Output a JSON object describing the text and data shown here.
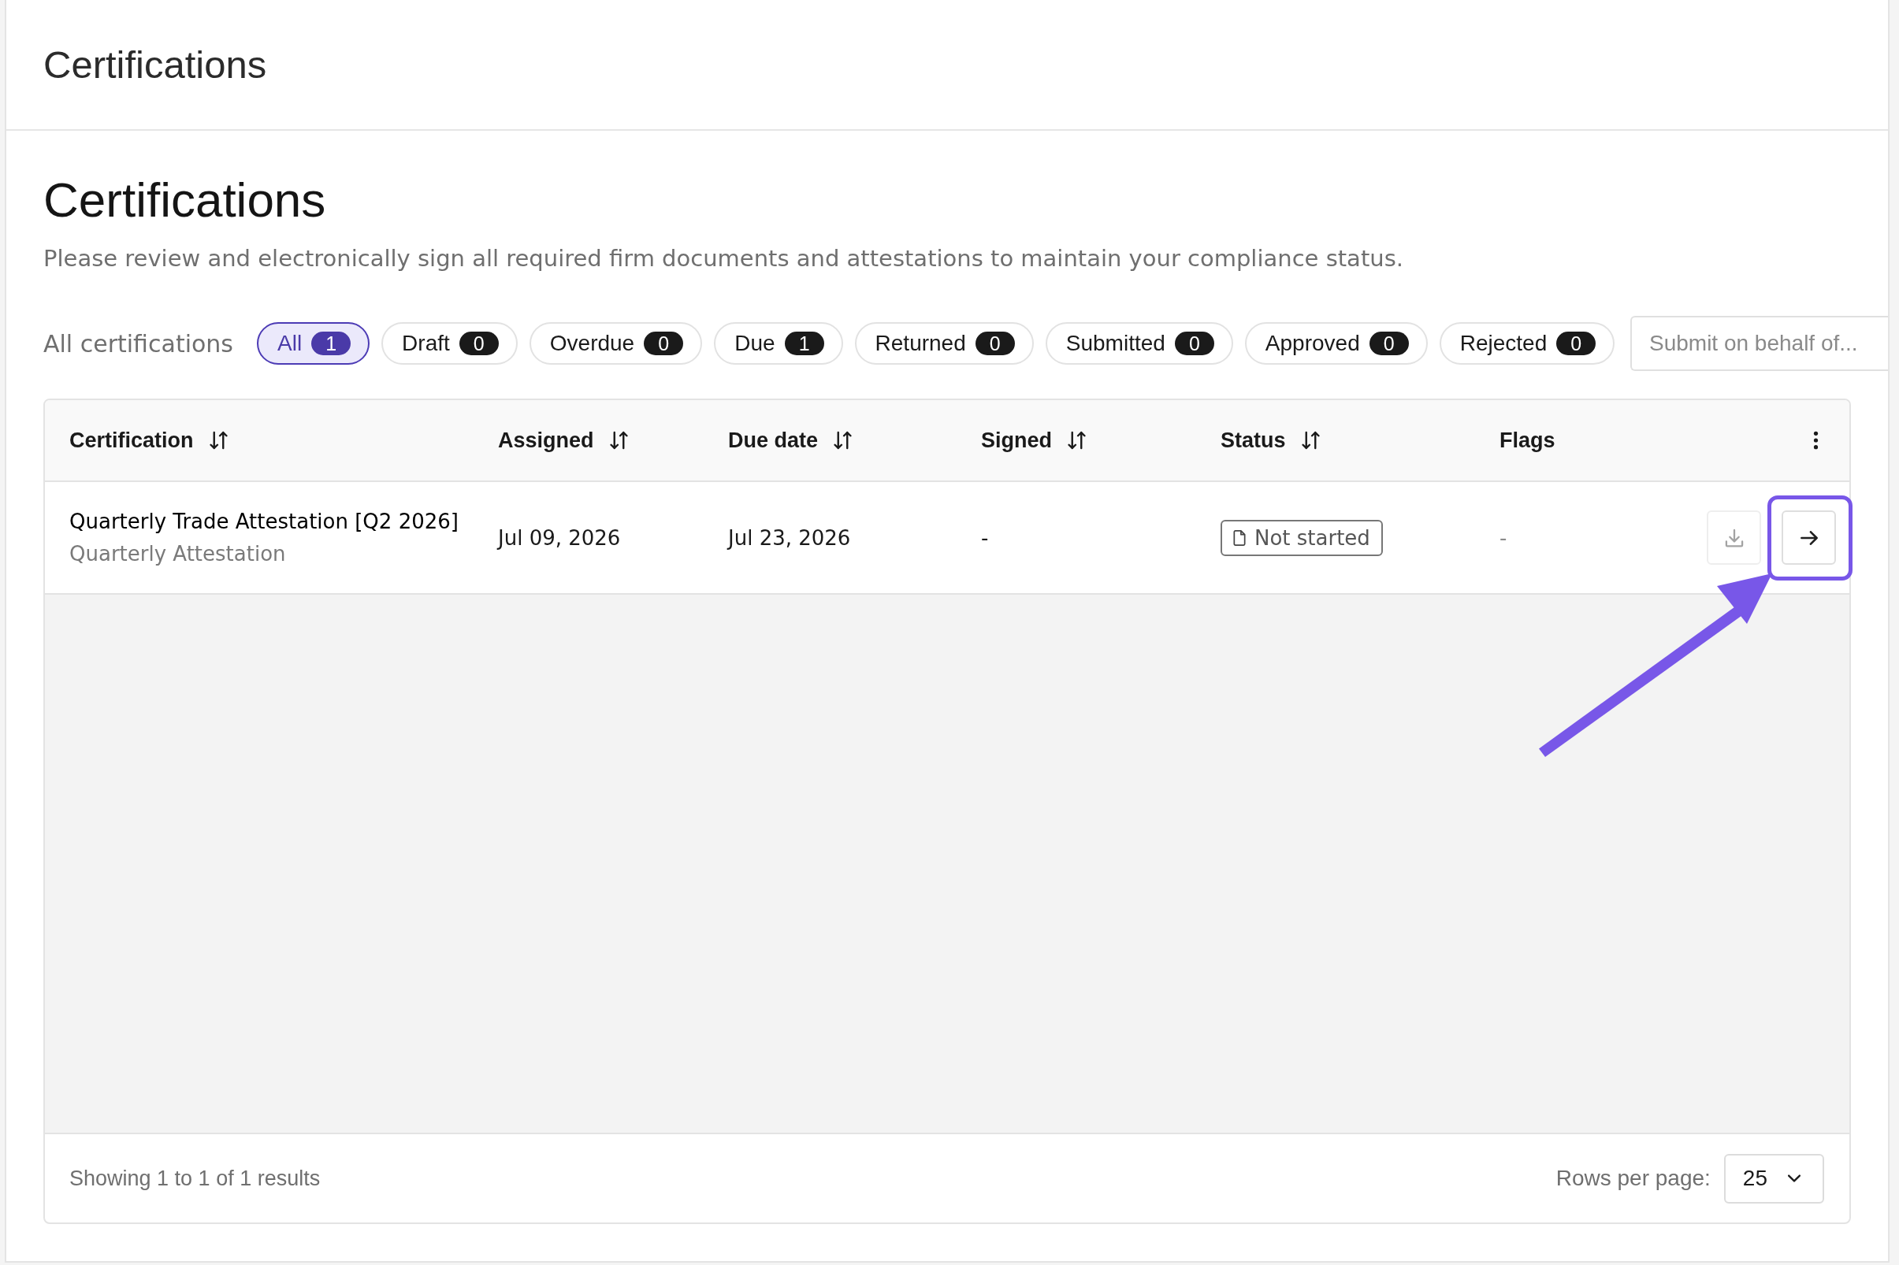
{
  "header": {
    "title": "Certifications"
  },
  "intro": {
    "title": "Certifications",
    "description": "Please review and electronically sign all required firm documents and attestations to maintain your compliance status."
  },
  "filters": {
    "label": "All certifications",
    "chips": [
      {
        "label": "All",
        "count": "1",
        "selected": true
      },
      {
        "label": "Draft",
        "count": "0",
        "selected": false
      },
      {
        "label": "Overdue",
        "count": "0",
        "selected": false
      },
      {
        "label": "Due",
        "count": "1",
        "selected": false
      },
      {
        "label": "Returned",
        "count": "0",
        "selected": false
      },
      {
        "label": "Submitted",
        "count": "0",
        "selected": false
      },
      {
        "label": "Approved",
        "count": "0",
        "selected": false
      },
      {
        "label": "Rejected",
        "count": "0",
        "selected": false
      }
    ],
    "submit_on_behalf": {
      "placeholder": "Submit on behalf of..."
    }
  },
  "table": {
    "columns": [
      {
        "label": "Certification",
        "sortable": true
      },
      {
        "label": "Assigned",
        "sortable": true
      },
      {
        "label": "Due date",
        "sortable": true
      },
      {
        "label": "Signed",
        "sortable": true
      },
      {
        "label": "Status",
        "sortable": true
      },
      {
        "label": "Flags",
        "sortable": false
      }
    ],
    "rows": [
      {
        "certification": "Quarterly Trade Attestation [Q2 2026]",
        "certification_type": "Quarterly Attestation",
        "assigned": "Jul 09, 2026",
        "due_date": "Jul 23, 2026",
        "signed": "-",
        "status": "Not started",
        "flags": "-",
        "actions": [
          {
            "kind": "download",
            "disabled": true,
            "highlighted": false
          },
          {
            "kind": "open",
            "disabled": false,
            "highlighted": true
          }
        ]
      }
    ]
  },
  "footer": {
    "summary": "Showing 1 to 1 of 1 results",
    "rows_per_page_label": "Rows per page:",
    "rows_per_page": "25"
  }
}
